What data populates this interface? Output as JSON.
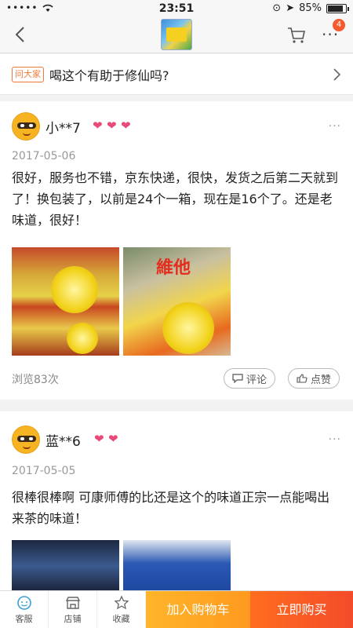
{
  "status_bar": {
    "time": "23:51",
    "battery_text": "85%",
    "battery_level": 0.85
  },
  "nav": {
    "badge": "4",
    "more_label": "···"
  },
  "question": {
    "tag": "问大家",
    "text": "喝这个有助于修仙吗?"
  },
  "reviews": [
    {
      "user": "小**7",
      "hearts": 3,
      "date": "2017-05-06",
      "text": "很好，服务也不错，京东快递，很快，发货之后第二天就到了！换包装了，以前是24个一箱，现在是16个了。还是老味道，很好！",
      "photo_brand": "維他",
      "views": "浏览83次",
      "comment_label": "评论",
      "like_label": "点赞"
    },
    {
      "user": "蓝**6",
      "hearts": 2,
      "date": "2017-05-05",
      "text": "很棒很棒啊 可康师傅的比还是这个的味道正宗一点能喝出来茶的味道！"
    }
  ],
  "bottom_bar": {
    "service": "客服",
    "shop": "店铺",
    "favorite": "收藏",
    "add_to_cart": "加入购物车",
    "buy_now": "立即购买"
  },
  "colors": {
    "accent": "#f07a3b",
    "cart_button": "#ffa826",
    "buy_button": "#f55528",
    "heart": "#e84a7a"
  }
}
